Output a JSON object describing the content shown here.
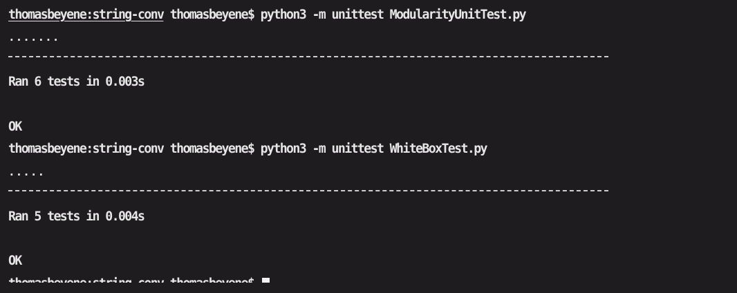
{
  "terminal": {
    "lines": [
      {
        "prompt": "thomasbeyene:string-conv",
        "rest": " thomasbeyene$ python3 -m unittest ModularityUnitTest.py"
      },
      {
        "text": "......."
      },
      {
        "text": "------------------------------------------------------------------------------------------"
      },
      {
        "text": "Ran 6 tests in 0.003s"
      },
      {
        "text": ""
      },
      {
        "text": "OK"
      },
      {
        "prompt": "thomasbeyene:string-conv",
        "rest": " thomasbeyene$ python3 -m unittest WhiteBoxTest.py"
      },
      {
        "text": "....."
      },
      {
        "text": "------------------------------------------------------------------------------------------"
      },
      {
        "text": "Ran 5 tests in 0.004s"
      },
      {
        "text": ""
      },
      {
        "text": "OK"
      },
      {
        "prompt": "thomasbeyene:string-conv",
        "rest": " thomasbeyene$ "
      }
    ]
  }
}
